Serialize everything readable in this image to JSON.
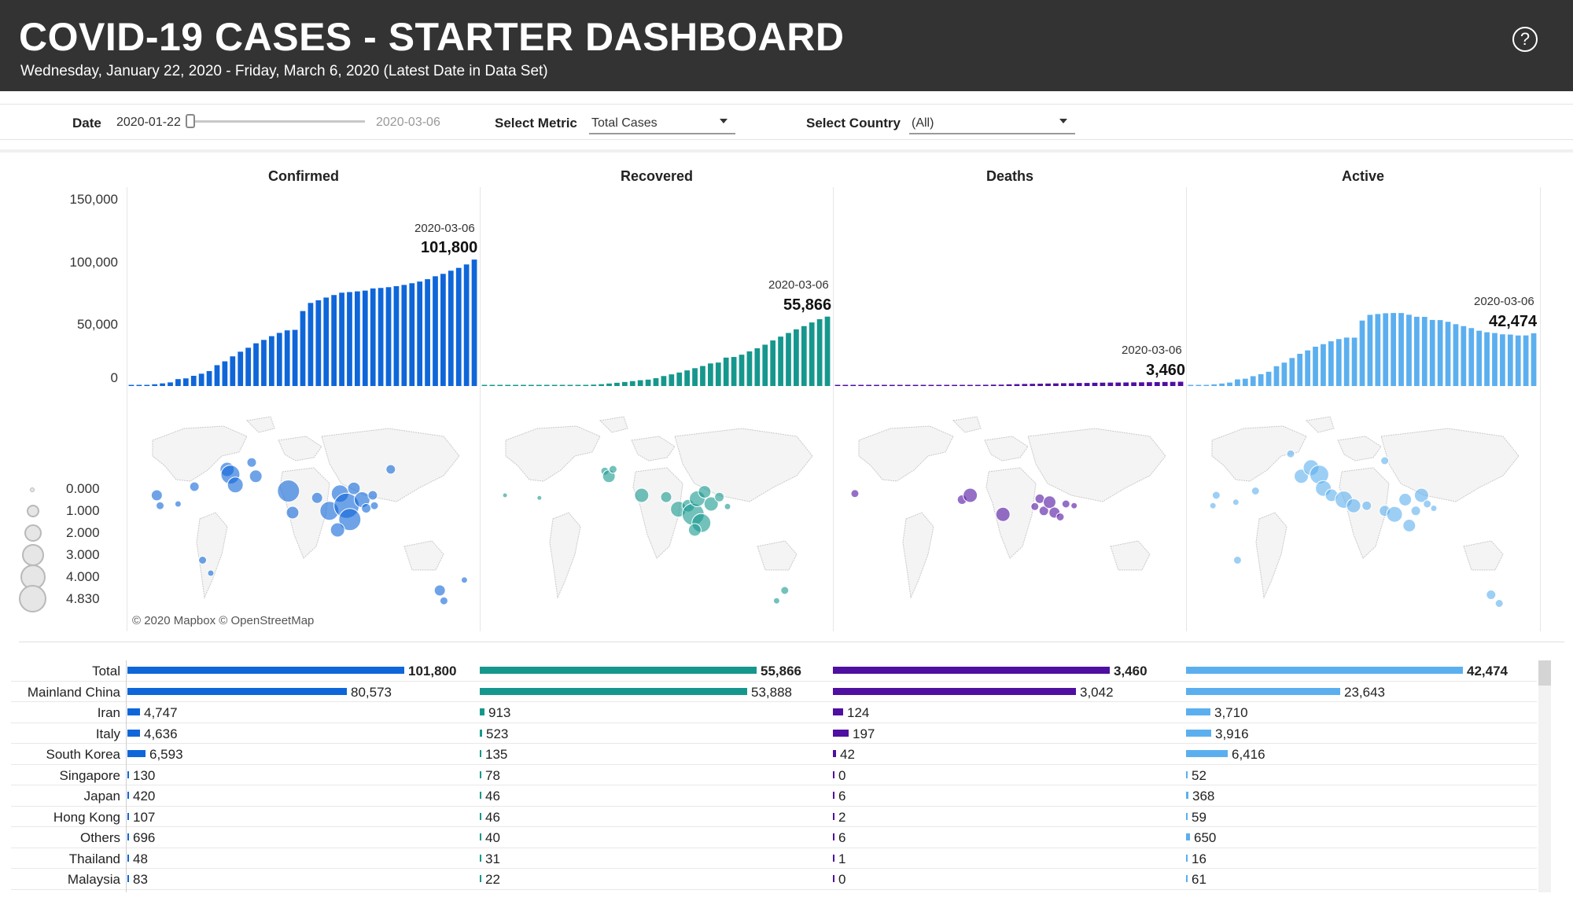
{
  "header": {
    "title": "COVID-19 CASES - STARTER DASHBOARD",
    "subtitle": "Wednesday, January 22, 2020 - Friday, March 6, 2020 (Latest Date in Data Set)",
    "help_label": "?"
  },
  "filters": {
    "date_label": "Date",
    "date_start": "2020-01-22",
    "date_end": "2020-03-06",
    "slider_position": 0,
    "metric_label": "Select Metric",
    "metric_value": "Total Cases",
    "country_label": "Select Country",
    "country_value": "(All)"
  },
  "colors": {
    "confirmed": "#0f66d9",
    "recovered": "#16978d",
    "deaths": "#4f0fa0",
    "active": "#5cafef"
  },
  "chart_data": [
    {
      "type": "bar",
      "title": "Confirmed",
      "ylim": [
        0,
        150000
      ],
      "yticks": [
        "150,000",
        "100,000",
        "50,000",
        "0"
      ],
      "annotation": {
        "date": "2020-03-06",
        "value": "101,800"
      },
      "x_start": "2020-01-22",
      "values": [
        555,
        653,
        941,
        1434,
        2118,
        2927,
        5578,
        6166,
        8234,
        9927,
        12038,
        16787,
        19881,
        23892,
        27635,
        30817,
        34391,
        37120,
        40150,
        42762,
        44802,
        45221,
        60368,
        66885,
        69030,
        71224,
        73258,
        75136,
        75639,
        76197,
        76819,
        78572,
        78958,
        79561,
        80406,
        81388,
        82746,
        84112,
        86011,
        88369,
        90306,
        92840,
        95120,
        97886,
        101800
      ]
    },
    {
      "type": "bar",
      "title": "Recovered",
      "annotation": {
        "date": "2020-03-06",
        "value": "55,866"
      },
      "x_start": "2020-01-22",
      "values": [
        28,
        30,
        36,
        39,
        52,
        61,
        107,
        126,
        143,
        222,
        284,
        472,
        623,
        852,
        1124,
        1487,
        2011,
        2616,
        3244,
        3946,
        4683,
        5150,
        6295,
        8058,
        9395,
        10865,
        12583,
        14352,
        16121,
        18177,
        18890,
        22886,
        23394,
        25227,
        27905,
        30384,
        33277,
        36711,
        39782,
        42716,
        45602,
        48228,
        51170,
        53796,
        55866
      ]
    },
    {
      "type": "bar",
      "title": "Deaths",
      "annotation": {
        "date": "2020-03-06",
        "value": "3,460"
      },
      "x_start": "2020-01-22",
      "values": [
        17,
        18,
        26,
        42,
        56,
        82,
        131,
        133,
        171,
        213,
        259,
        362,
        426,
        492,
        564,
        634,
        719,
        806,
        906,
        1013,
        1113,
        1118,
        1371,
        1523,
        1666,
        1770,
        1868,
        2007,
        2122,
        2247,
        2251,
        2458,
        2469,
        2629,
        2708,
        2770,
        2814,
        2872,
        2941,
        2996,
        3085,
        3160,
        3254,
        3348,
        3460
      ]
    },
    {
      "type": "bar",
      "title": "Active",
      "annotation": {
        "date": "2020-03-06",
        "value": "42,474"
      },
      "x_start": "2020-01-22",
      "values": [
        510,
        605,
        879,
        1353,
        2010,
        2784,
        5340,
        5907,
        7920,
        9492,
        11495,
        15953,
        18832,
        22548,
        25947,
        28696,
        31661,
        33698,
        36000,
        37803,
        39006,
        38953,
        52702,
        57304,
        57969,
        58589,
        58807,
        58777,
        57396,
        55773,
        55678,
        53228,
        53095,
        51705,
        49793,
        48234,
        46655,
        44529,
        43288,
        42657,
        41619,
        41452,
        40696,
        40742,
        42474
      ]
    }
  ],
  "maps": {
    "credit": "© 2020 Mapbox © OpenStreetMap",
    "legend": [
      {
        "label": "0.000"
      },
      {
        "label": "1.000"
      },
      {
        "label": "2.000"
      },
      {
        "label": "3.000"
      },
      {
        "label": "4.000"
      },
      {
        "label": "4.830"
      }
    ]
  },
  "table": {
    "rows": [
      {
        "name": "Total",
        "confirmed": "101,800",
        "recovered": "55,866",
        "deaths": "3,460",
        "active": "42,474",
        "c": 101800,
        "r": 55866,
        "d": 3460,
        "a": 42474
      },
      {
        "name": "Mainland China",
        "confirmed": "80,573",
        "recovered": "53,888",
        "deaths": "3,042",
        "active": "23,643",
        "c": 80573,
        "r": 53888,
        "d": 3042,
        "a": 23643
      },
      {
        "name": "Iran",
        "confirmed": "4,747",
        "recovered": "913",
        "deaths": "124",
        "active": "3,710",
        "c": 4747,
        "r": 913,
        "d": 124,
        "a": 3710
      },
      {
        "name": "Italy",
        "confirmed": "4,636",
        "recovered": "523",
        "deaths": "197",
        "active": "3,916",
        "c": 4636,
        "r": 523,
        "d": 197,
        "a": 3916
      },
      {
        "name": "South Korea",
        "confirmed": "6,593",
        "recovered": "135",
        "deaths": "42",
        "active": "6,416",
        "c": 6593,
        "r": 135,
        "d": 42,
        "a": 6416
      },
      {
        "name": "Singapore",
        "confirmed": "130",
        "recovered": "78",
        "deaths": "0",
        "active": "52",
        "c": 130,
        "r": 78,
        "d": 0,
        "a": 52
      },
      {
        "name": "Japan",
        "confirmed": "420",
        "recovered": "46",
        "deaths": "6",
        "active": "368",
        "c": 420,
        "r": 46,
        "d": 6,
        "a": 368
      },
      {
        "name": "Hong Kong",
        "confirmed": "107",
        "recovered": "46",
        "deaths": "2",
        "active": "59",
        "c": 107,
        "r": 46,
        "d": 2,
        "a": 59
      },
      {
        "name": "Others",
        "confirmed": "696",
        "recovered": "40",
        "deaths": "6",
        "active": "650",
        "c": 696,
        "r": 40,
        "d": 6,
        "a": 650
      },
      {
        "name": "Thailand",
        "confirmed": "48",
        "recovered": "31",
        "deaths": "1",
        "active": "16",
        "c": 48,
        "r": 31,
        "d": 1,
        "a": 16
      },
      {
        "name": "Malaysia",
        "confirmed": "83",
        "recovered": "22",
        "deaths": "0",
        "active": "61",
        "c": 83,
        "r": 22,
        "d": 0,
        "a": 61
      }
    ]
  }
}
